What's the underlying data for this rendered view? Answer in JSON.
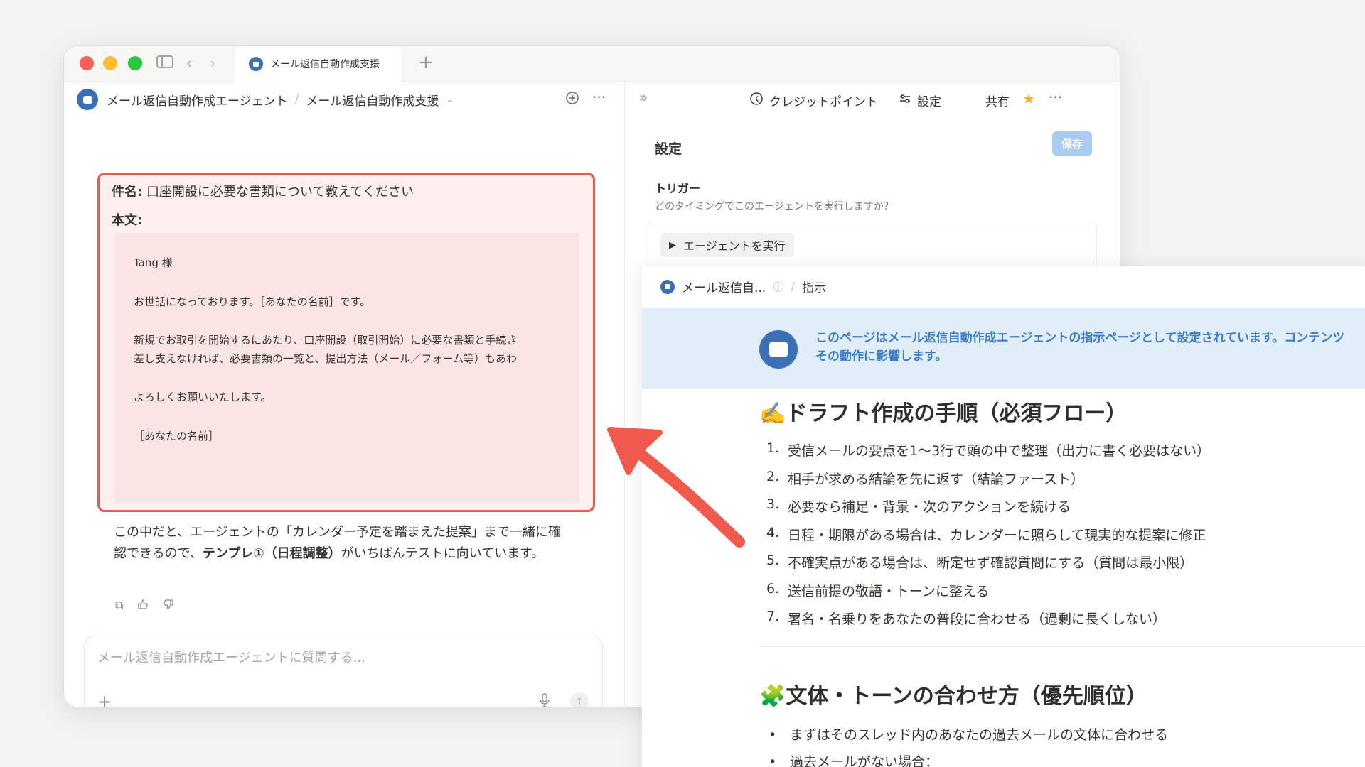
{
  "tab": {
    "title": "メール返信自動作成支援"
  },
  "left_header": {
    "agent_name": "メール返信自動作成エージェント",
    "page_name": "メール返信自動作成支援"
  },
  "mail": {
    "subject_label": "件名:",
    "subject": "口座開設に必要な書類について教えてください",
    "body_label": "本文:",
    "greeting": "Tang 様",
    "line1": "お世話になっております。［あなたの名前］です。",
    "line2a": "新規でお取引を開始するにあたり、口座開設（取引開始）に必要な書類と手続き",
    "line2b": "差し支えなければ、必要書類の一覧と、提出方法（メール／フォーム等）もあわ",
    "line3": "よろしくお願いいたします。",
    "signature": "［あなたの名前］"
  },
  "reply": {
    "part1": "この中だと、エージェントの「カレンダー予定を踏まえた提案」まで一緒に確認できるので、",
    "bold": "テンプレ①（日程調整）",
    "part2": "がいちばんテストに向いています。"
  },
  "composer": {
    "placeholder": "メール返信自動作成エージェントに質問する..."
  },
  "right_header": {
    "credits": "クレジットポイント",
    "settings": "設定",
    "share": "共有"
  },
  "settings": {
    "title": "設定",
    "save": "保存",
    "trigger_label": "トリガー",
    "trigger_desc": "どのタイミングでこのエージェントを実行しますか？",
    "run_button": "エージェントを実行"
  },
  "doc": {
    "crumb_page": "メール返信自...",
    "crumb_current": "指示",
    "callout_line1": "このページはメール返信自動作成エージェントの指示ページとして設定されています。コンテンツ",
    "callout_line2": "その動作に影響します。",
    "h2_draft": "✍️ドラフト作成の手順（必須フロー）",
    "steps": [
      {
        "n": "1.",
        "t": "受信メールの要点を1〜3行で頭の中で整理（出力に書く必要はない）"
      },
      {
        "n": "2.",
        "t": "相手が求める結論を先に返す（結論ファースト）"
      },
      {
        "n": "3.",
        "t": "必要なら補足・背景・次のアクションを続ける"
      },
      {
        "n": "4.",
        "t": "日程・期限がある場合は、カレンダーに照らして現実的な提案に修正"
      },
      {
        "n": "5.",
        "t": "不確実点がある場合は、断定せず確認質問にする（質問は最小限）"
      },
      {
        "n": "6.",
        "t": "送信前提の敬語・トーンに整える"
      },
      {
        "n": "7.",
        "t": "署名・名乗りをあなたの普段に合わせる（過剰に長くしない）"
      }
    ],
    "h2_tone": "🧩文体・トーンの合わせ方（優先順位）",
    "bullets": [
      "まずはそのスレッド内のあなたの過去メールの文体に合わせる",
      "過去メールがない場合："
    ]
  },
  "colors": {
    "highlight_border": "#eb5a50",
    "highlight_fill": "#fff0ef",
    "arrow": "#ef5a4c",
    "callout_bg": "#e1eefa",
    "callout_text": "#3b7ec6",
    "save_button": "#a8cdf0",
    "star": "#f2b230"
  },
  "icons": {
    "sidebar": "sidebar-toggle-icon",
    "back": "chevron-left-icon",
    "forward": "chevron-right-icon",
    "new_chat": "new-chat-icon",
    "more": "more-horizontal-icon",
    "collapse": "double-chevron-right-icon",
    "credits": "coin-icon",
    "settings": "sliders-icon",
    "star": "star-icon",
    "copy": "copy-icon",
    "thumbs_up": "thumbs-up-icon",
    "thumbs_down": "thumbs-down-icon",
    "attach": "plus-icon",
    "mic": "microphone-icon",
    "send": "arrow-up-icon",
    "info": "info-icon",
    "run": "play-icon"
  }
}
